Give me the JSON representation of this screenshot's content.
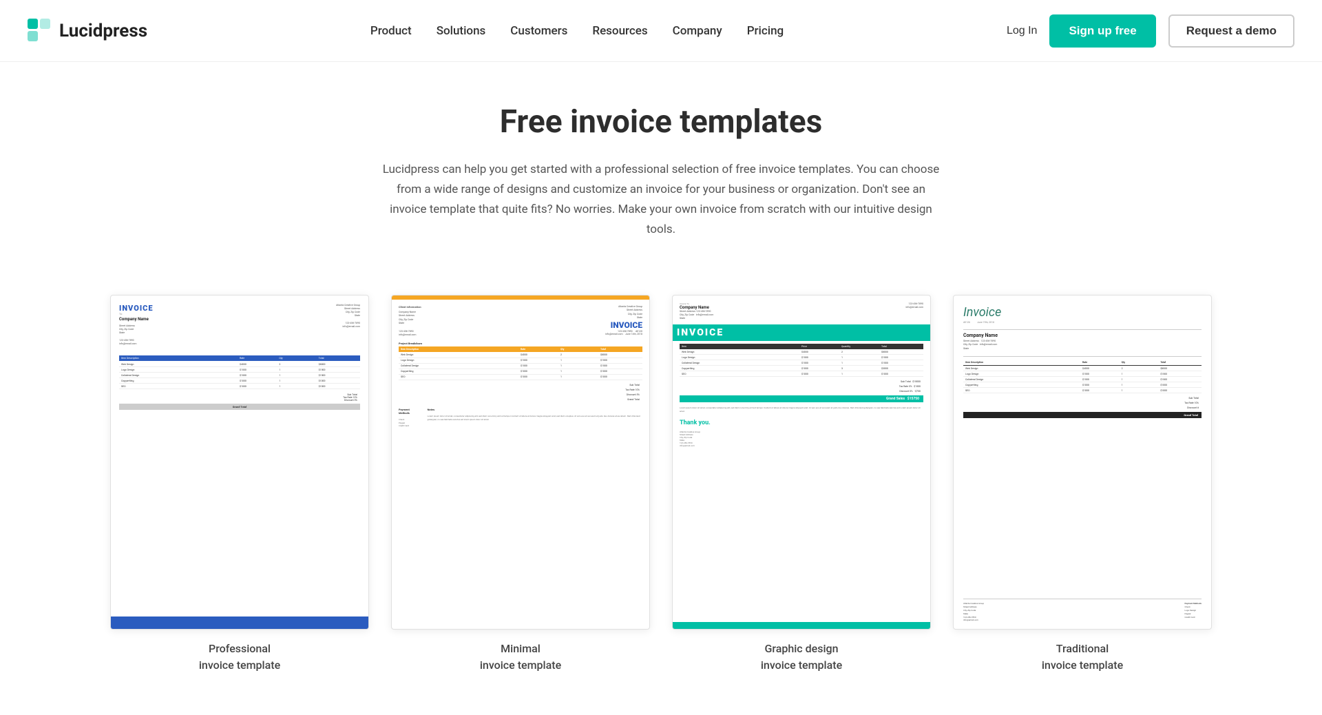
{
  "header": {
    "logo_text": "Lucidpress",
    "nav": {
      "items": [
        {
          "label": "Product",
          "id": "product"
        },
        {
          "label": "Solutions",
          "id": "solutions"
        },
        {
          "label": "Customers",
          "id": "customers"
        },
        {
          "label": "Resources",
          "id": "resources"
        },
        {
          "label": "Company",
          "id": "company"
        },
        {
          "label": "Pricing",
          "id": "pricing"
        }
      ]
    },
    "login_label": "Log In",
    "signup_label": "Sign up free",
    "demo_label": "Request a demo"
  },
  "hero": {
    "title": "Free invoice templates",
    "description": "Lucidpress can help you get started with a professional selection of free invoice templates. You can choose from a wide range of designs and customize an invoice for your business or organization. Don't see an invoice template that quite fits? No worries. Make your own invoice from scratch with our intuitive design tools."
  },
  "templates": [
    {
      "id": "professional",
      "label_line1": "Professional",
      "label_line2": "invoice template"
    },
    {
      "id": "minimal",
      "label_line1": "Minimal",
      "label_line2": "invoice template"
    },
    {
      "id": "graphic-design",
      "label_line1": "Graphic design",
      "label_line2": "invoice template"
    },
    {
      "id": "traditional",
      "label_line1": "Traditional",
      "label_line2": "invoice template"
    }
  ],
  "colors": {
    "teal": "#00bfa5",
    "blue": "#2b5cbf",
    "yellow": "#f5a623",
    "dark": "#222",
    "text": "#333"
  }
}
